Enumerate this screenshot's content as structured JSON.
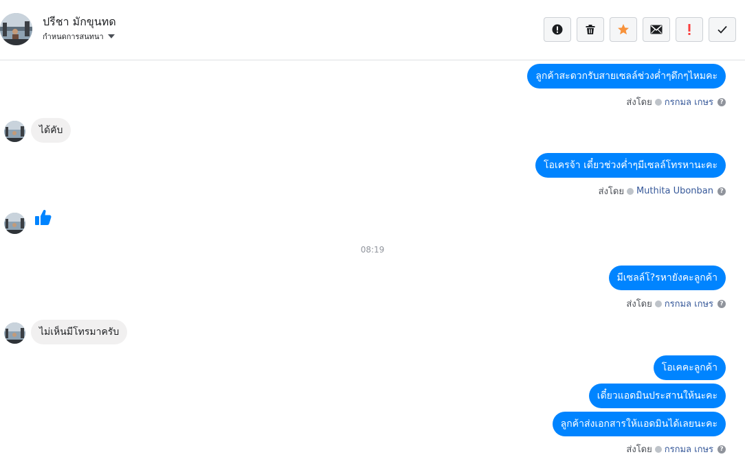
{
  "header": {
    "name": "ปรีชา มักขุนทด",
    "subtitle": "กำหนดการสนทนา",
    "avatar_icon": "user-photo-avatar"
  },
  "toolbar": [
    {
      "name": "report-button",
      "icon": "exclamation-circle-icon",
      "color": "#1c1e21"
    },
    {
      "name": "delete-button",
      "icon": "trash-icon",
      "color": "#1c1e21"
    },
    {
      "name": "star-button",
      "icon": "star-icon",
      "color": "#f7923b"
    },
    {
      "name": "mark-unread-button",
      "icon": "envelope-icon",
      "color": "#1c1e21"
    },
    {
      "name": "important-button",
      "icon": "exclamation-icon",
      "color": "#fa3e3e"
    },
    {
      "name": "done-button",
      "icon": "checkmark-icon",
      "color": "#1c1e21"
    }
  ],
  "colors": {
    "outgoing_bubble": "#0084ff",
    "incoming_bubble": "#f1f0f0",
    "like_icon": "#0084ff"
  },
  "messages": {
    "m1": "ลูกค้าสะดวกรับสายเซลล์ช่วงค่ำๆดึกๆไหมคะ",
    "m1_sent_prefix": "ส่งโดย",
    "m1_sender": "กรกมล เกษร",
    "m2": "ได้คับ",
    "m3": "โอเครจ้า เดี๋ยวช่วงค่ำๆมีเซลล์โทรหานะคะ",
    "m3_sent_prefix": "ส่งโดย",
    "m3_sender": "Muthita Ubonban",
    "m4_icon": "thumbs-up-icon",
    "time": "08:19",
    "m5": "มีเซลล์โ?รหายังคะลูกค้า",
    "m5_sent_prefix": "ส่งโดย",
    "m5_sender": "กรกมล เกษร",
    "m6": "ไม่เห็นมีโทรมาครับ",
    "m7": "โอเคคะลูกค้า",
    "m8": "เดี๋ยวแอดมินประสานให้นะคะ",
    "m9": "ลูกค้าส่งเอกสารให้แอดมินได้เลยนะคะ",
    "m9_sent_prefix": "ส่งโดย",
    "m9_sender": "กรกมล เกษร"
  }
}
